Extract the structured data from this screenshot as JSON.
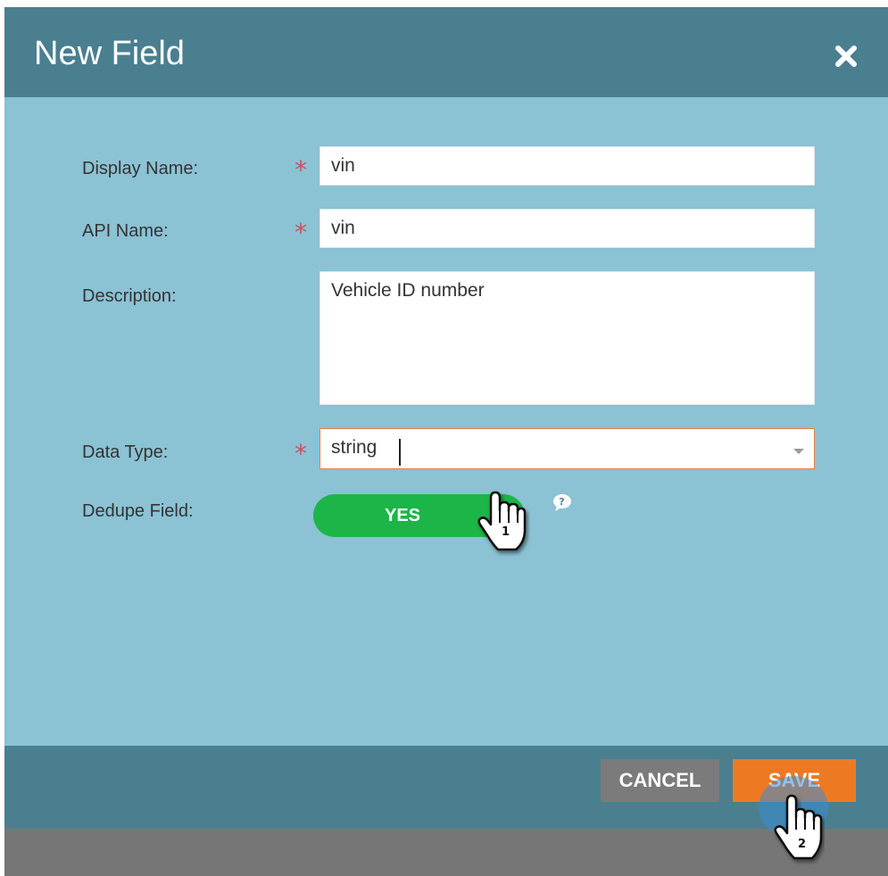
{
  "dialog": {
    "title": "New Field",
    "close_icon": "close-icon"
  },
  "form": {
    "display_name": {
      "label": "Display Name:",
      "value": "vin",
      "required": true
    },
    "api_name": {
      "label": "API Name:",
      "value": "vin",
      "required": true
    },
    "description": {
      "label": "Description:",
      "value": "Vehicle ID number"
    },
    "data_type": {
      "label": "Data Type:",
      "value": "string",
      "required": true
    },
    "dedupe_field": {
      "label": "Dedupe Field:",
      "toggle_label": "YES",
      "help_icon": "question-bubble-icon"
    }
  },
  "footer": {
    "cancel_label": "CANCEL",
    "save_label": "SAVE"
  },
  "annotations": {
    "step_1": "1",
    "step_2": "2"
  },
  "colors": {
    "header": "#4a7f90",
    "body": "#8bc2d4",
    "toggle_on": "#1cb548",
    "save": "#ed7a22",
    "cancel": "#7c7b7b",
    "required": "#c9535b"
  }
}
